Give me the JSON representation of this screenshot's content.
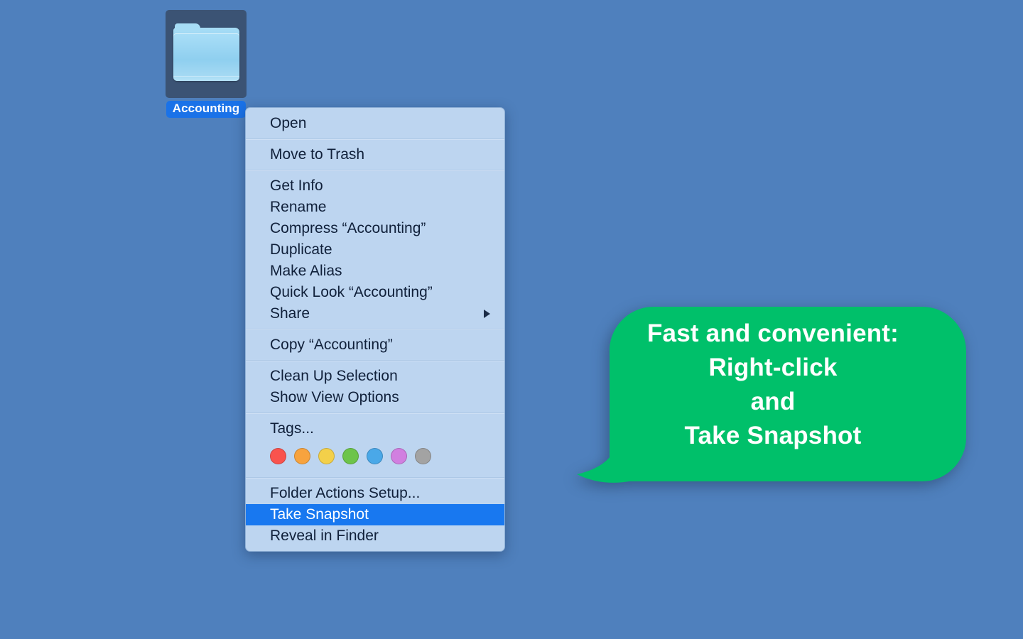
{
  "desktop": {
    "background_color": "#4f80bd"
  },
  "folder": {
    "name": "Accounting",
    "icon": "folder-icon",
    "selected": true,
    "label_background": "#1a72e8",
    "tile_background": "#3b5374"
  },
  "context_menu": {
    "background_color": "#bdd5f0",
    "text_color": "#10203a",
    "highlight_color": "#1878f0",
    "sections": [
      {
        "id": "open",
        "items": [
          {
            "label": "Open",
            "highlighted": false,
            "submenu": false
          }
        ]
      },
      {
        "id": "trash",
        "items": [
          {
            "label": "Move to Trash",
            "highlighted": false,
            "submenu": false
          }
        ]
      },
      {
        "id": "file-actions",
        "items": [
          {
            "label": "Get Info",
            "highlighted": false,
            "submenu": false
          },
          {
            "label": "Rename",
            "highlighted": false,
            "submenu": false
          },
          {
            "label": "Compress “Accounting”",
            "highlighted": false,
            "submenu": false
          },
          {
            "label": "Duplicate",
            "highlighted": false,
            "submenu": false
          },
          {
            "label": "Make Alias",
            "highlighted": false,
            "submenu": false
          },
          {
            "label": "Quick Look “Accounting”",
            "highlighted": false,
            "submenu": false
          },
          {
            "label": "Share",
            "highlighted": false,
            "submenu": true
          }
        ]
      },
      {
        "id": "copy",
        "items": [
          {
            "label": "Copy “Accounting”",
            "highlighted": false,
            "submenu": false
          }
        ]
      },
      {
        "id": "view",
        "items": [
          {
            "label": "Clean Up Selection",
            "highlighted": false,
            "submenu": false
          },
          {
            "label": "Show View Options",
            "highlighted": false,
            "submenu": false
          }
        ]
      },
      {
        "id": "tags",
        "items": [
          {
            "label": "Tags...",
            "highlighted": false,
            "submenu": false
          }
        ],
        "tag_colors": [
          {
            "name": "red",
            "hex": "#f9534e"
          },
          {
            "name": "orange",
            "hex": "#f7a33e"
          },
          {
            "name": "yellow",
            "hex": "#f3d04a"
          },
          {
            "name": "green",
            "hex": "#6dc44a"
          },
          {
            "name": "blue",
            "hex": "#4aa8e8"
          },
          {
            "name": "purple",
            "hex": "#d17fe0"
          },
          {
            "name": "gray",
            "hex": "#a3a3a3"
          }
        ]
      },
      {
        "id": "services",
        "items": [
          {
            "label": "Folder Actions Setup...",
            "highlighted": false,
            "submenu": false
          },
          {
            "label": "Take Snapshot",
            "highlighted": true,
            "submenu": false
          },
          {
            "label": "Reveal in Finder",
            "highlighted": false,
            "submenu": false
          }
        ]
      }
    ]
  },
  "callout": {
    "background_color": "#00c06a",
    "text_color": "#ffffff",
    "lines": [
      "Fast and convenient:",
      "Right-click",
      "and",
      "Take Snapshot"
    ]
  }
}
